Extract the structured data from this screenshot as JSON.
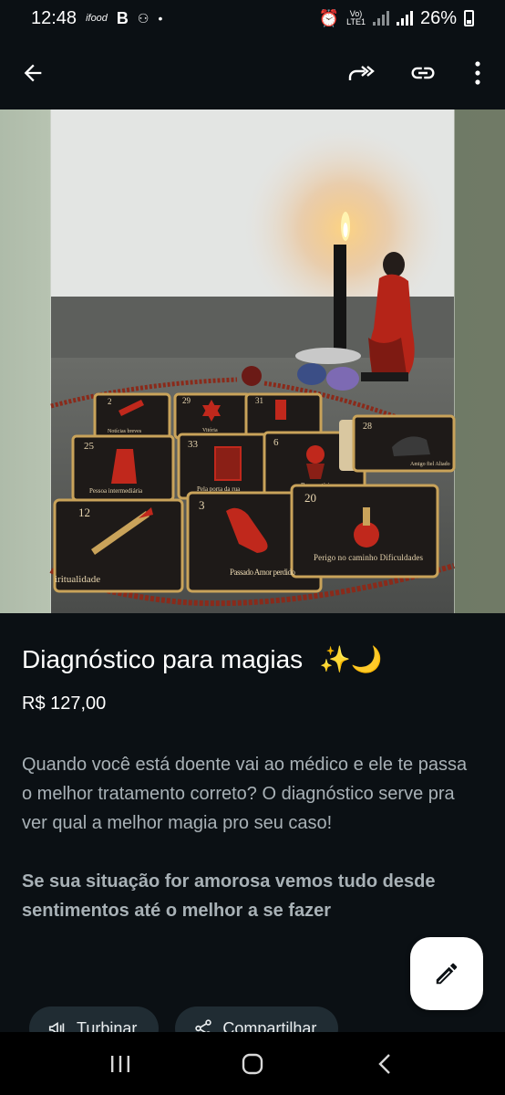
{
  "status_bar": {
    "time": "12:48",
    "left_icons": [
      "ifood-icon",
      "b-icon",
      "voicemail-icon"
    ],
    "dot": "•",
    "volte_top": "Vo)",
    "volte_bottom": "LTE1",
    "battery": "26%"
  },
  "toolbar": {
    "back": "arrow-left-icon",
    "actions": [
      "forward-icon",
      "link-icon",
      "more-vertical-icon"
    ]
  },
  "photo": {
    "card_labels": [
      "Notícias breves",
      "Vitória",
      "Pessoa intermediária",
      "Pela porta da rua",
      "Boas notícias",
      "Passado Amor perdido",
      "Perigo no caminho Dificuldades",
      "Amigo fiel Aliado"
    ],
    "card_numbers": [
      "2",
      "29",
      "31",
      "25",
      "33",
      "6",
      "12",
      "3",
      "20",
      "28"
    ],
    "partial_text": "iritualidade"
  },
  "product": {
    "title": "Diagnóstico para magias",
    "title_emoji": "✨🌙",
    "price": "R$ 127,00",
    "description": "Quando você está doente vai ao médico e ele te passa o melhor tratamento correto? O diagnóstico serve pra ver qual a melhor magia pro seu caso!",
    "description_bold": "Se sua situação for amorosa vemos tudo desde sentimentos até o melhor a se  fazer"
  },
  "actions": {
    "boost_label": "Turbinar",
    "share_label": "Compartilhar"
  },
  "nav": {
    "recents": "recents-icon",
    "home": "home-icon",
    "back": "back-icon"
  }
}
